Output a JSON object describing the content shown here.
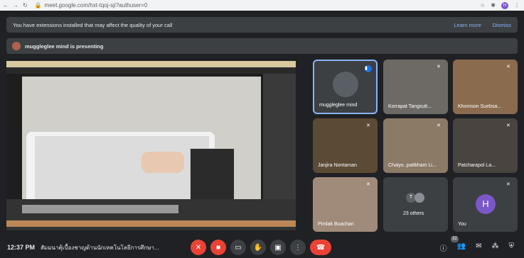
{
  "browser": {
    "url": "meet.google.com/hxt-tqoj-sji?authuser=0",
    "profile_letter": "H"
  },
  "banner": {
    "message": "You have extensions installed that may affect the quality of your call",
    "learn_more": "Learn more",
    "dismiss": "Dismiss"
  },
  "presenting": {
    "text": "muggleglee mind is presenting"
  },
  "participants": [
    {
      "name": "muggleglee mind",
      "active": true
    },
    {
      "name": "Korrapat Tangsutt..."
    },
    {
      "name": "Khomson Suebsa..."
    },
    {
      "name": "Janjira Nontaman"
    },
    {
      "name": "Chaiyo..pattkham Li..."
    },
    {
      "name": "Patcharapol La..."
    },
    {
      "name": "Pimlak Buachan"
    },
    {
      "name": "23 others",
      "letter": "T"
    },
    {
      "name": "You",
      "letter": "H"
    }
  ],
  "bottom": {
    "time": "12:37 PM",
    "meeting_title": "สัมมนาคุ้เบื้องชาญด้านนักเทคโนโลยีการศึกษา...",
    "participant_count": "32"
  },
  "colors": {
    "accent": "#8ab4f8",
    "end_call": "#ea4335",
    "you_avatar": "#7b57c9"
  }
}
